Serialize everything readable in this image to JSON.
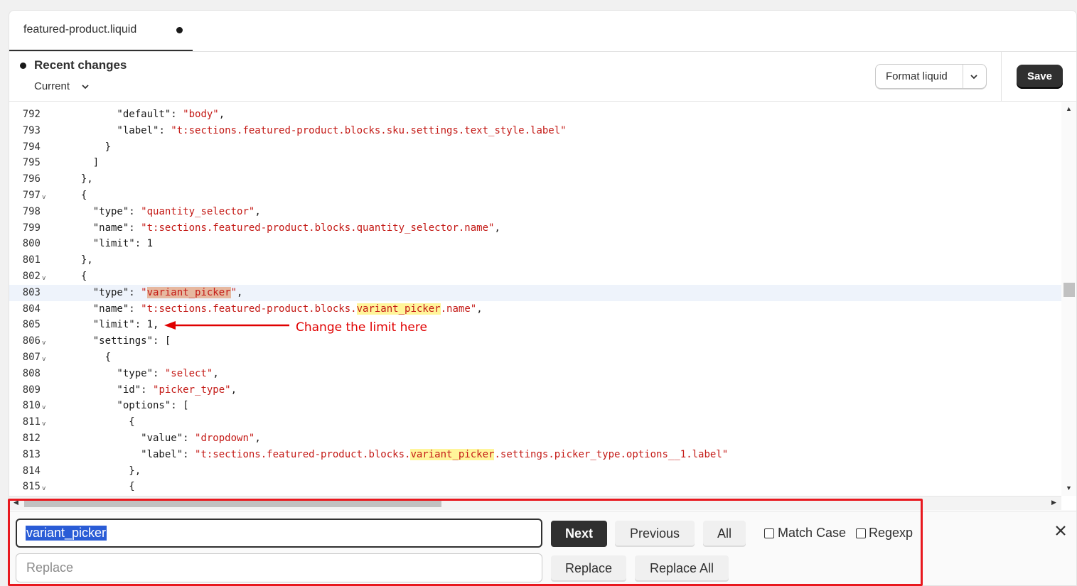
{
  "tab": {
    "filename": "featured-product.liquid"
  },
  "toolbar": {
    "recent_changes": "Recent changes",
    "version": "Current",
    "format_label": "Format liquid",
    "save_label": "Save"
  },
  "editor": {
    "active_line": 803,
    "lines": [
      {
        "n": "792",
        "fold": false,
        "code": [
          [
            "k",
            "        \"default\""
          ],
          [
            "p",
            ": "
          ],
          [
            "s",
            "\"body\""
          ],
          [
            "p",
            ","
          ]
        ]
      },
      {
        "n": "793",
        "fold": false,
        "code": [
          [
            "k",
            "        \"label\""
          ],
          [
            "p",
            ": "
          ],
          [
            "s",
            "\"t:sections.featured-product.blocks.sku.settings.text_style.label\""
          ]
        ]
      },
      {
        "n": "794",
        "fold": false,
        "code": [
          [
            "p",
            "      }"
          ]
        ]
      },
      {
        "n": "795",
        "fold": false,
        "code": [
          [
            "p",
            "    ]"
          ]
        ]
      },
      {
        "n": "796",
        "fold": false,
        "code": [
          [
            "p",
            "  },"
          ]
        ]
      },
      {
        "n": "797",
        "fold": true,
        "code": [
          [
            "p",
            "  {"
          ]
        ]
      },
      {
        "n": "798",
        "fold": false,
        "code": [
          [
            "k",
            "    \"type\""
          ],
          [
            "p",
            ": "
          ],
          [
            "s",
            "\"quantity_selector\""
          ],
          [
            "p",
            ","
          ]
        ]
      },
      {
        "n": "799",
        "fold": false,
        "code": [
          [
            "k",
            "    \"name\""
          ],
          [
            "p",
            ": "
          ],
          [
            "s",
            "\"t:sections.featured-product.blocks.quantity_selector.name\""
          ],
          [
            "p",
            ","
          ]
        ]
      },
      {
        "n": "800",
        "fold": false,
        "code": [
          [
            "k",
            "    \"limit\""
          ],
          [
            "p",
            ": "
          ],
          [
            "n",
            "1"
          ]
        ]
      },
      {
        "n": "801",
        "fold": false,
        "code": [
          [
            "p",
            "  },"
          ]
        ]
      },
      {
        "n": "802",
        "fold": true,
        "code": [
          [
            "p",
            "  {"
          ]
        ]
      },
      {
        "n": "803",
        "fold": false,
        "code": [
          [
            "k",
            "    \"type\""
          ],
          [
            "p",
            ": "
          ],
          [
            "s",
            "\""
          ],
          [
            "s hl-cur",
            "variant_picker"
          ],
          [
            "s",
            "\""
          ],
          [
            "p",
            ","
          ]
        ]
      },
      {
        "n": "804",
        "fold": false,
        "code": [
          [
            "k",
            "    \"name\""
          ],
          [
            "p",
            ": "
          ],
          [
            "s",
            "\"t:sections.featured-product.blocks."
          ],
          [
            "s hl",
            "variant_picker"
          ],
          [
            "s",
            ".name\""
          ],
          [
            "p",
            ","
          ]
        ]
      },
      {
        "n": "805",
        "fold": false,
        "code": [
          [
            "k",
            "    \"limit\""
          ],
          [
            "p",
            ": "
          ],
          [
            "n",
            "1"
          ],
          [
            "p",
            ","
          ]
        ]
      },
      {
        "n": "806",
        "fold": true,
        "code": [
          [
            "k",
            "    \"settings\""
          ],
          [
            "p",
            ": ["
          ]
        ]
      },
      {
        "n": "807",
        "fold": true,
        "code": [
          [
            "p",
            "      {"
          ]
        ]
      },
      {
        "n": "808",
        "fold": false,
        "code": [
          [
            "k",
            "        \"type\""
          ],
          [
            "p",
            ": "
          ],
          [
            "s",
            "\"select\""
          ],
          [
            "p",
            ","
          ]
        ]
      },
      {
        "n": "809",
        "fold": false,
        "code": [
          [
            "k",
            "        \"id\""
          ],
          [
            "p",
            ": "
          ],
          [
            "s",
            "\"picker_type\""
          ],
          [
            "p",
            ","
          ]
        ]
      },
      {
        "n": "810",
        "fold": true,
        "code": [
          [
            "k",
            "        \"options\""
          ],
          [
            "p",
            ": ["
          ]
        ]
      },
      {
        "n": "811",
        "fold": true,
        "code": [
          [
            "p",
            "          {"
          ]
        ]
      },
      {
        "n": "812",
        "fold": false,
        "code": [
          [
            "k",
            "            \"value\""
          ],
          [
            "p",
            ": "
          ],
          [
            "s",
            "\"dropdown\""
          ],
          [
            "p",
            ","
          ]
        ]
      },
      {
        "n": "813",
        "fold": false,
        "code": [
          [
            "k",
            "            \"label\""
          ],
          [
            "p",
            ": "
          ],
          [
            "s",
            "\"t:sections.featured-product.blocks."
          ],
          [
            "s hl",
            "variant_picker"
          ],
          [
            "s",
            ".settings.picker_type.options__1.label\""
          ]
        ]
      },
      {
        "n": "814",
        "fold": false,
        "code": [
          [
            "p",
            "          },"
          ]
        ]
      },
      {
        "n": "815",
        "fold": true,
        "code": [
          [
            "p",
            "          {"
          ]
        ]
      }
    ]
  },
  "annotation": {
    "text": "Change the limit here"
  },
  "search": {
    "find_value": "variant_picker",
    "replace_placeholder": "Replace",
    "next_label": "Next",
    "previous_label": "Previous",
    "all_label": "All",
    "match_case_label": "Match Case",
    "regexp_label": "Regexp",
    "replace_label": "Replace",
    "replace_all_label": "Replace All"
  },
  "colors": {
    "string": "#c41a16",
    "match_highlight": "#fff59a",
    "current_match": "#e6b8a0",
    "annotation": "#e00000",
    "accent_dark": "#303030"
  }
}
